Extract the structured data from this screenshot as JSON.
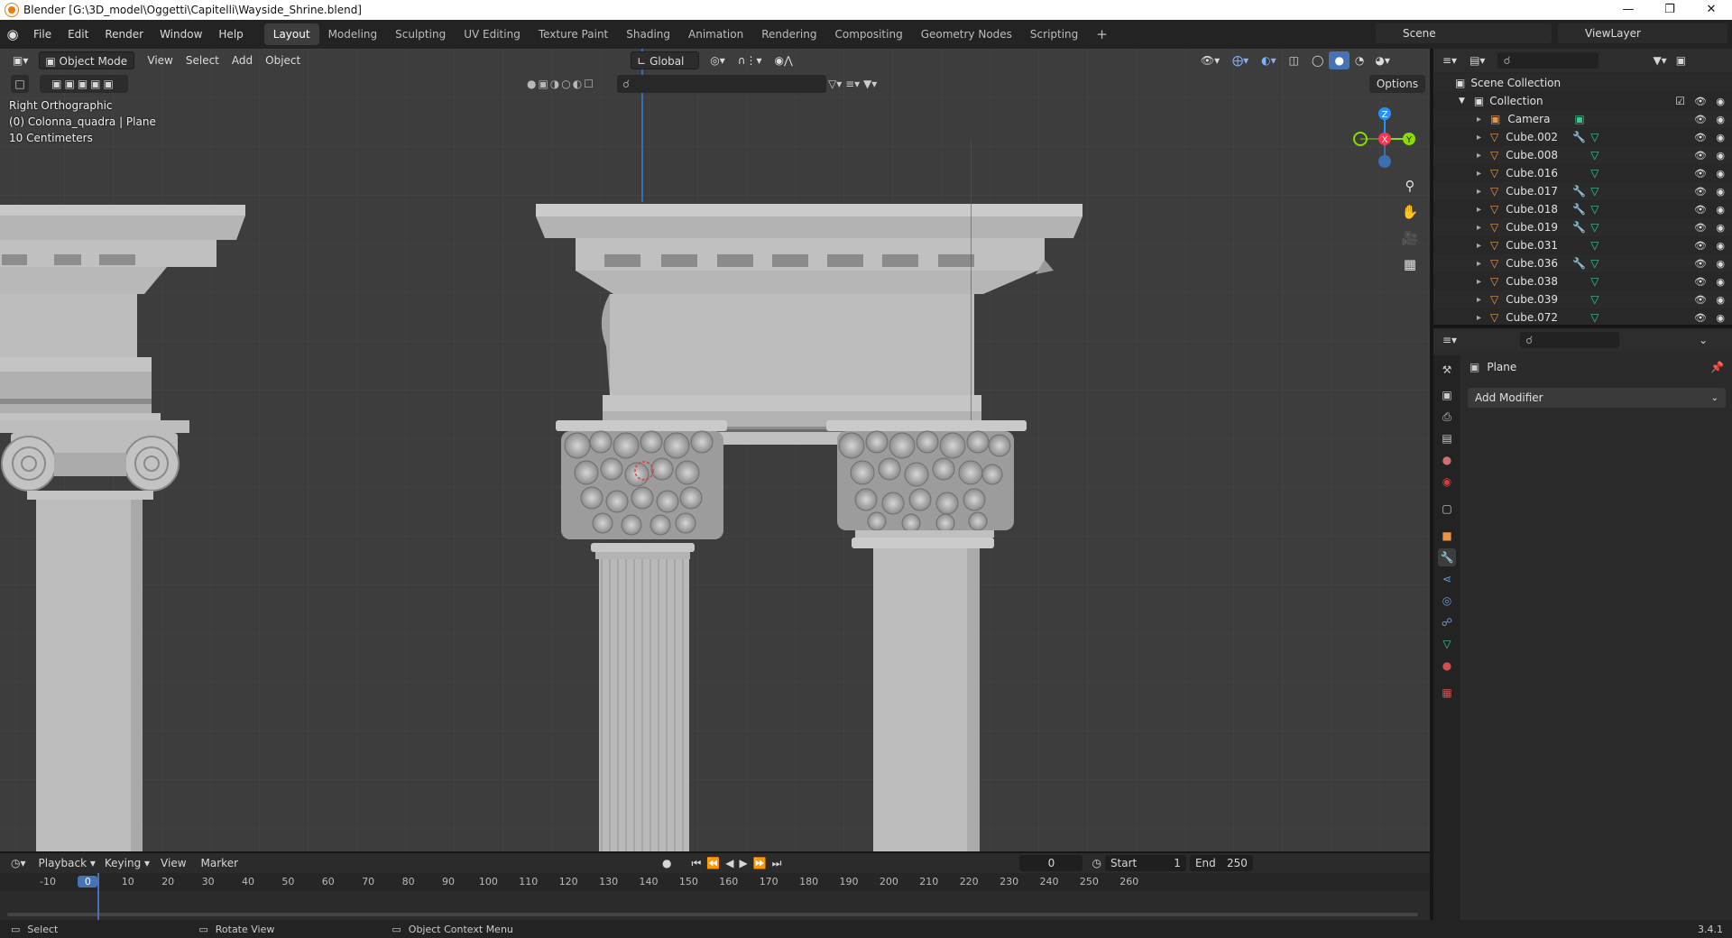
{
  "title_bar": {
    "text": "Blender [G:\\3D_model\\Oggetti\\Capitelli\\Wayside_Shrine.blend]"
  },
  "menu": [
    "File",
    "Edit",
    "Render",
    "Window",
    "Help"
  ],
  "workspaces": [
    "Layout",
    "Modeling",
    "Sculpting",
    "UV Editing",
    "Texture Paint",
    "Shading",
    "Animation",
    "Rendering",
    "Compositing",
    "Geometry Nodes",
    "Scripting"
  ],
  "active_workspace": "Layout",
  "scene_name": "Scene",
  "view_layer": "ViewLayer",
  "viewport": {
    "mode": "Object Mode",
    "menus": [
      "View",
      "Select",
      "Add",
      "Object"
    ],
    "transform_orientation": "Global",
    "options_label": "Options",
    "view_name": "Right Orthographic",
    "active_object": "(0) Colonna_quadra | Plane",
    "grid_scale": "10 Centimeters",
    "gizmo_axes": {
      "z": "Z",
      "y": "Y",
      "x": "X"
    }
  },
  "outliner": {
    "root": "Scene Collection",
    "collection": "Collection",
    "items": [
      {
        "name": "Camera",
        "type": "camera"
      },
      {
        "name": "Cube.002",
        "type": "mesh",
        "modifier": true
      },
      {
        "name": "Cube.008",
        "type": "mesh",
        "modifier": false
      },
      {
        "name": "Cube.016",
        "type": "mesh",
        "modifier": false
      },
      {
        "name": "Cube.017",
        "type": "mesh",
        "modifier": true
      },
      {
        "name": "Cube.018",
        "type": "mesh",
        "modifier": true
      },
      {
        "name": "Cube.019",
        "type": "mesh",
        "modifier": true
      },
      {
        "name": "Cube.031",
        "type": "mesh",
        "modifier": false
      },
      {
        "name": "Cube.036",
        "type": "mesh",
        "modifier": true
      },
      {
        "name": "Cube.038",
        "type": "mesh",
        "modifier": false
      },
      {
        "name": "Cube.039",
        "type": "mesh",
        "modifier": false
      },
      {
        "name": "Cube.072",
        "type": "mesh",
        "modifier": false
      }
    ]
  },
  "properties": {
    "object_name": "Plane",
    "add_modifier_label": "Add Modifier"
  },
  "timeline": {
    "menus": [
      "Playback",
      "Keying",
      "View",
      "Marker"
    ],
    "current_frame": "0",
    "start_label": "Start",
    "start_value": "1",
    "end_label": "End",
    "end_value": "250",
    "ruler_labels": [
      "-10",
      "0",
      "10",
      "20",
      "30",
      "40",
      "50",
      "60",
      "70",
      "80",
      "90",
      "100",
      "110",
      "120",
      "130",
      "140",
      "150",
      "160",
      "170",
      "180",
      "190",
      "200",
      "210",
      "220",
      "230",
      "240",
      "250",
      "260"
    ]
  },
  "status_bar": {
    "select": "Select",
    "rotate": "Rotate View",
    "context": "Object Context Menu",
    "version": "3.4.1"
  },
  "colors": {
    "accent_blue": "#4772b3",
    "axis_x": "#ff3352",
    "axis_y": "#8bdc00",
    "axis_z": "#2890ff",
    "mesh_orange": "#e89645",
    "modifier_blue": "#6c9bd2",
    "mesh_data_green": "#3ac98f"
  }
}
